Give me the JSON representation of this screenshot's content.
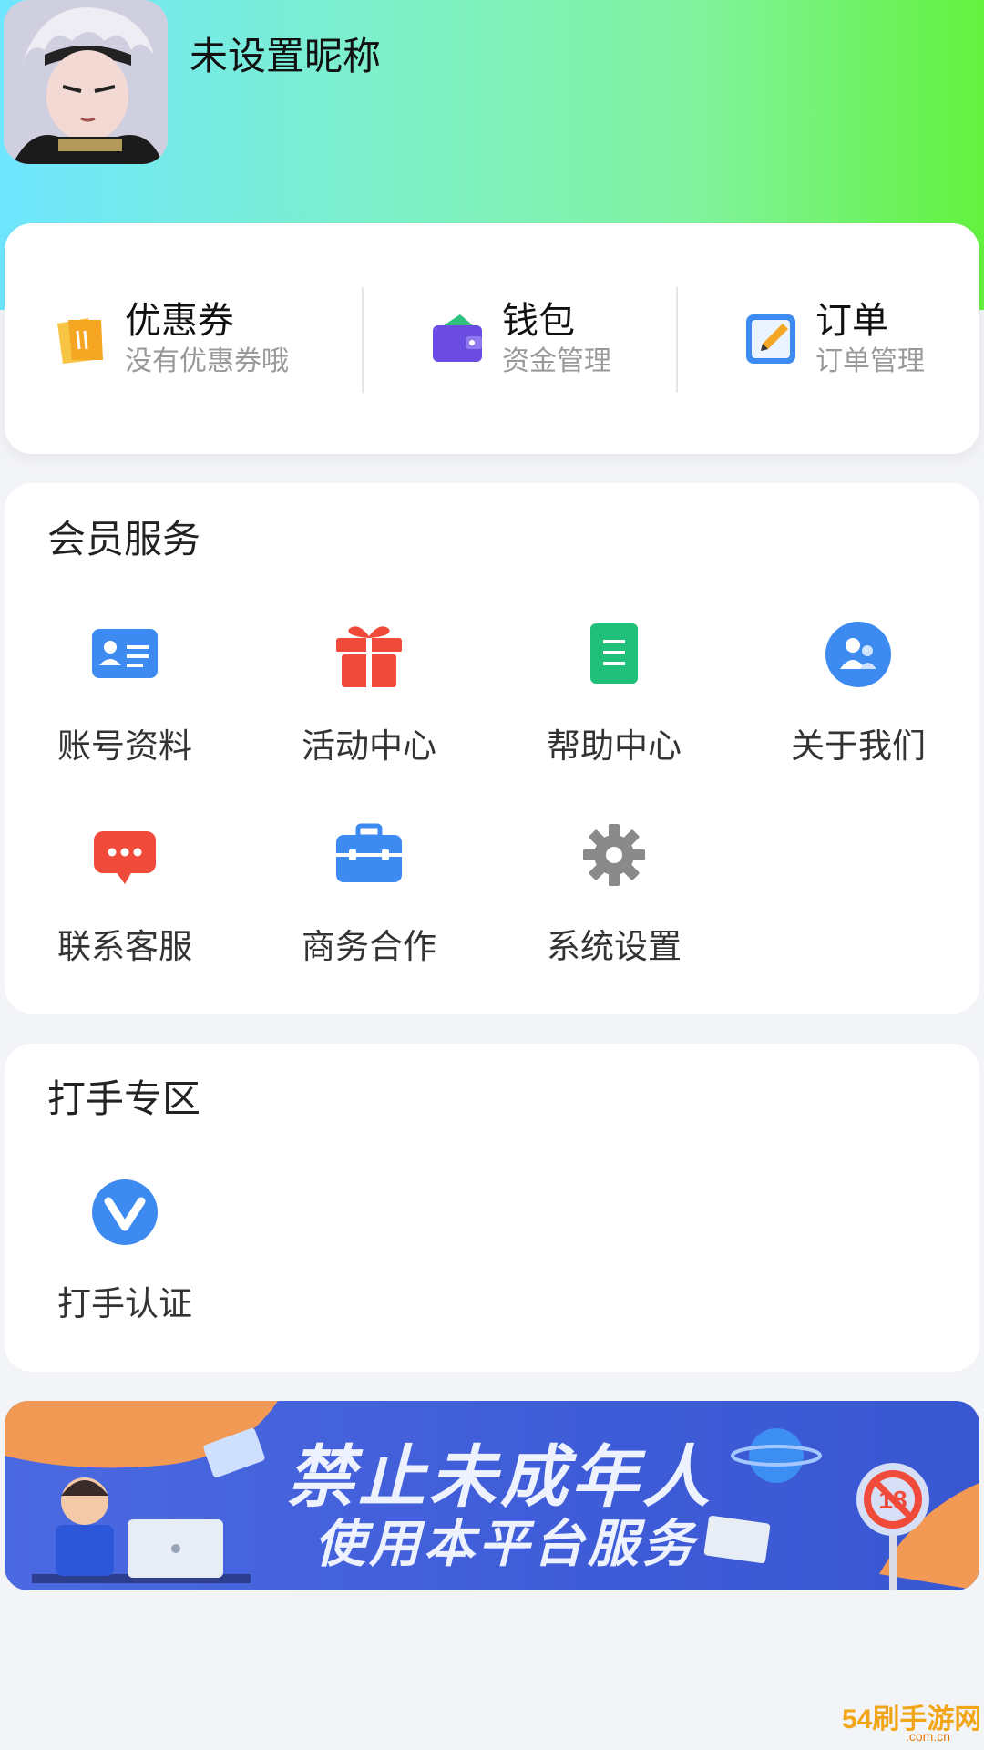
{
  "profile": {
    "nickname": "未设置昵称"
  },
  "quick": [
    {
      "title": "优惠券",
      "sub": "没有优惠券哦",
      "icon": "coupon-icon"
    },
    {
      "title": "钱包",
      "sub": "资金管理",
      "icon": "wallet-icon"
    },
    {
      "title": "订单",
      "sub": "订单管理",
      "icon": "order-icon"
    }
  ],
  "member": {
    "title": "会员服务",
    "items": [
      {
        "label": "账号资料",
        "icon": "id-card-icon"
      },
      {
        "label": "活动中心",
        "icon": "gift-icon"
      },
      {
        "label": "帮助中心",
        "icon": "document-icon"
      },
      {
        "label": "关于我们",
        "icon": "people-icon"
      },
      {
        "label": "联系客服",
        "icon": "chat-icon"
      },
      {
        "label": "商务合作",
        "icon": "briefcase-icon"
      },
      {
        "label": "系统设置",
        "icon": "gear-icon"
      }
    ]
  },
  "player": {
    "title": "打手专区",
    "items": [
      {
        "label": "打手认证",
        "icon": "verified-v-icon"
      }
    ]
  },
  "banner": {
    "line1": "禁止未成年人",
    "line2": "使用本平台服务",
    "badge": "18"
  },
  "watermark": {
    "text": "54刷手游网",
    "domain": ".com.cn"
  },
  "colors": {
    "blue": "#3d8bf0",
    "red": "#f04a3a",
    "green": "#20c07a",
    "gray": "#8a8a8a",
    "yellow": "#f5b533",
    "purple": "#6a4de0"
  }
}
